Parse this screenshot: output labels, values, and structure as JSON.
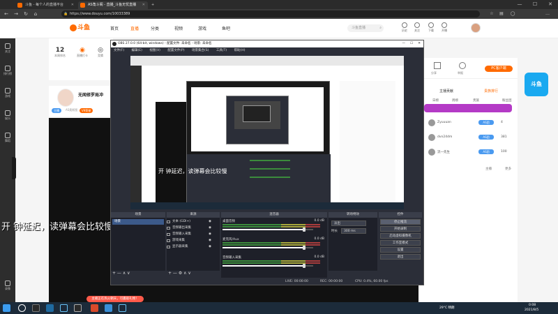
{
  "browser": {
    "tabs": [
      {
        "title": "斗鱼 - 每个人的直播平台",
        "active": false
      },
      {
        "title": "AS角斗阁 - 直播_斗鱼无忧直播",
        "active": true
      }
    ],
    "new_tab": "+",
    "url": "https://www.douyu.com/10033389",
    "window_controls": [
      "—",
      "☐",
      "✕"
    ]
  },
  "site": {
    "logo_text": "斗鱼",
    "nav": [
      {
        "label": "首页",
        "active": false
      },
      {
        "label": "直播",
        "active": true
      },
      {
        "label": "分类",
        "active": false
      },
      {
        "label": "视频",
        "active": false
      },
      {
        "label": "游戏",
        "active": false
      },
      {
        "label": "鱼吧",
        "active": false
      }
    ],
    "search_placeholder": "斗鱼直播",
    "header_icons": [
      {
        "icon": "history-icon",
        "label": "历史"
      },
      {
        "icon": "follow-icon",
        "label": "关注"
      },
      {
        "icon": "download-icon",
        "label": "下载"
      },
      {
        "icon": "publish-icon",
        "label": "开播"
      }
    ],
    "left_nav": [
      {
        "icon": "follow-icon",
        "label": "关注"
      },
      {
        "icon": "rank-icon",
        "label": "排行榜"
      },
      {
        "icon": "game-icon",
        "label": "游戏"
      },
      {
        "icon": "entertain-icon",
        "label": "娱乐"
      },
      {
        "icon": "dance-icon",
        "label": "舞蹈"
      },
      {
        "icon": "record-icon",
        "label": "录像"
      }
    ]
  },
  "room": {
    "stats": [
      {
        "num": "12",
        "label": "本周排名"
      },
      {
        "num": "",
        "label": "直播打卡"
      },
      {
        "num": "",
        "label": "竞猜"
      }
    ],
    "anchor_name": "无闻修罗局冲",
    "anchor_sub": "AS奥斯图",
    "badges": [
      "主播",
      "V9荣誉"
    ]
  },
  "danmu": {
    "line_big": "开        钟延迟，读弹幕会比较慢",
    "line_mid": "开      钟延迟，读弹幕会比较慢"
  },
  "right": {
    "pc_button": "PC客户端",
    "top_icons": [
      {
        "label": "分享"
      },
      {
        "label": "举报"
      }
    ],
    "section_title": "主播贡献",
    "section_link": "贵族排行",
    "rank_tabs": [
      "日榜",
      "周榜",
      "贵族"
    ],
    "tab_right": "粉丝团",
    "rank_rows": [
      {
        "name": "Zyuuuan",
        "badge": "AS团",
        "val": "4"
      },
      {
        "name": "dvn24dm",
        "badge": "AS团",
        "val": "381"
      },
      {
        "name": "流一先生",
        "badge": "AS团",
        "val": "100"
      }
    ],
    "more_left": "主播",
    "more_right": "更多",
    "side_badge": "斗鱼"
  },
  "obs": {
    "title": "OBS 27.0.0 (64-bit, windows) - 配置文件: 未命名 - 场景: 未命名",
    "menu": [
      "文件(F)",
      "编辑(E)",
      "视图(V)",
      "配置文件(P)",
      "场景集合(S)",
      "工具(T)",
      "帮助(H)"
    ],
    "docks": {
      "scenes": "场景",
      "sources": "来源",
      "mixer": "混音器",
      "transitions": "转场特效",
      "controls": "控件"
    },
    "scene_name": "场景",
    "sources": [
      {
        "name": "文本 (GDI+)"
      },
      {
        "name": "音频输出采集"
      },
      {
        "name": "音频输入采集"
      },
      {
        "name": "游戏采集"
      },
      {
        "name": "显示器采集"
      }
    ],
    "mixer": [
      {
        "name": "桌面音频",
        "db": "0.0 dB",
        "fill": 0.9
      },
      {
        "name": "麦克风/Aux",
        "db": "0.0 dB",
        "fill": 0.9
      },
      {
        "name": "音频输入采集",
        "db": "0.0 dB",
        "fill": 0.9
      }
    ],
    "transition": {
      "type": "淡出",
      "duration_label": "时长",
      "duration": "300 ms"
    },
    "controls": [
      "停止推流",
      "开始录制",
      "启动虚拟摄像机",
      "工作室模式",
      "设置",
      "退出"
    ],
    "status": {
      "live": "LIVE: 00:00:00",
      "rec": "REC: 00:00:00",
      "cpu": "CPU: 0.4%, 60.00 fps"
    }
  },
  "taskbar": {
    "toast": "主播正在热火朝天，可赢取礼物！",
    "weather": "29°C 晴朗",
    "time": "0:08",
    "date": "2021/8/5"
  }
}
